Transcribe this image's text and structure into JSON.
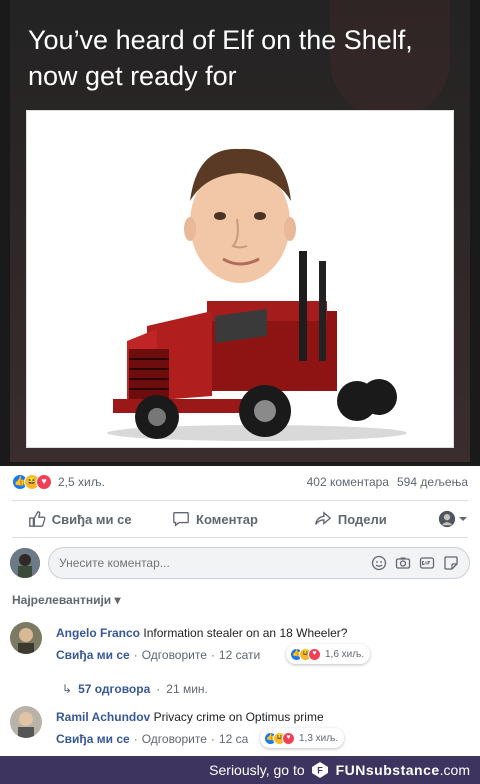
{
  "post": {
    "caption_line1": "You’ve heard of Elf on the Shelf,",
    "caption_line2": "now get ready for",
    "reactions_count": "2,5 хиљ.",
    "comments_count": "402 коментара",
    "shares_count": "594 дељења"
  },
  "actions": {
    "like_label": "Свиђа ми се",
    "comment_label": "Коментар",
    "share_label": "Подели"
  },
  "composer": {
    "placeholder": "Унесите коментар..."
  },
  "sort_label": "Најрелевантнији",
  "comments": [
    {
      "author": "Angelo Franco",
      "text": "Information stealer on an 18 Wheeler?",
      "like_link": "Свиђа ми се",
      "reply_link": "Одговорите",
      "time": "12 сати",
      "reaction_count": "1,6 хиљ."
    },
    {
      "author": "Ramil Achundov",
      "text": "Privacy crime on Optimus prime",
      "like_link": "Свиђа ми се",
      "reply_link": "Одговорите",
      "time": "12 са",
      "reaction_count": "1,3 хиљ."
    }
  ],
  "replies": {
    "label": "57 одговора",
    "time": "21 мин."
  },
  "footer": {
    "text": "Seriously, go to",
    "brand": "FUNsubstance",
    "domain": ".com"
  },
  "colors": {
    "accent": "#385898",
    "like_blue": "#1877f2",
    "haha_yellow": "#f7b928",
    "love_red": "#f33e58",
    "footer_bg": "#3d3560"
  }
}
